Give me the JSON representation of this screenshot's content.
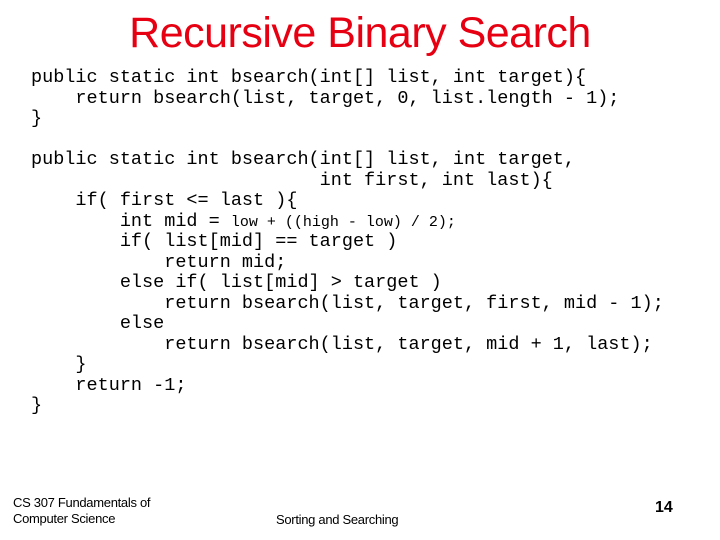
{
  "slide": {
    "title": "Recursive Binary Search",
    "title_color": "#e60012",
    "code": {
      "lines": [
        "public static int bsearch(int[] list, int target){",
        "    return bsearch(list, target, 0, list.length - 1);",
        "}",
        "",
        "public static int bsearch(int[] list, int target,",
        "                          int first, int last){",
        "    if( first <= last ){",
        "        int mid = ",
        "        if( list[mid] == target )",
        "            return mid;",
        "        else if( list[mid] > target )",
        "            return bsearch(list, target, first, mid - 1);",
        "        else",
        "            return bsearch(list, target, mid + 1, last);",
        "    }",
        "    return -1;",
        "}"
      ],
      "mid_expression_small": "low + ((high - low) / 2);"
    },
    "footer": {
      "course_line1": "CS 307 Fundamentals of",
      "course_line2": "Computer Science",
      "topic": "Sorting and Searching",
      "page_number": "14"
    }
  }
}
